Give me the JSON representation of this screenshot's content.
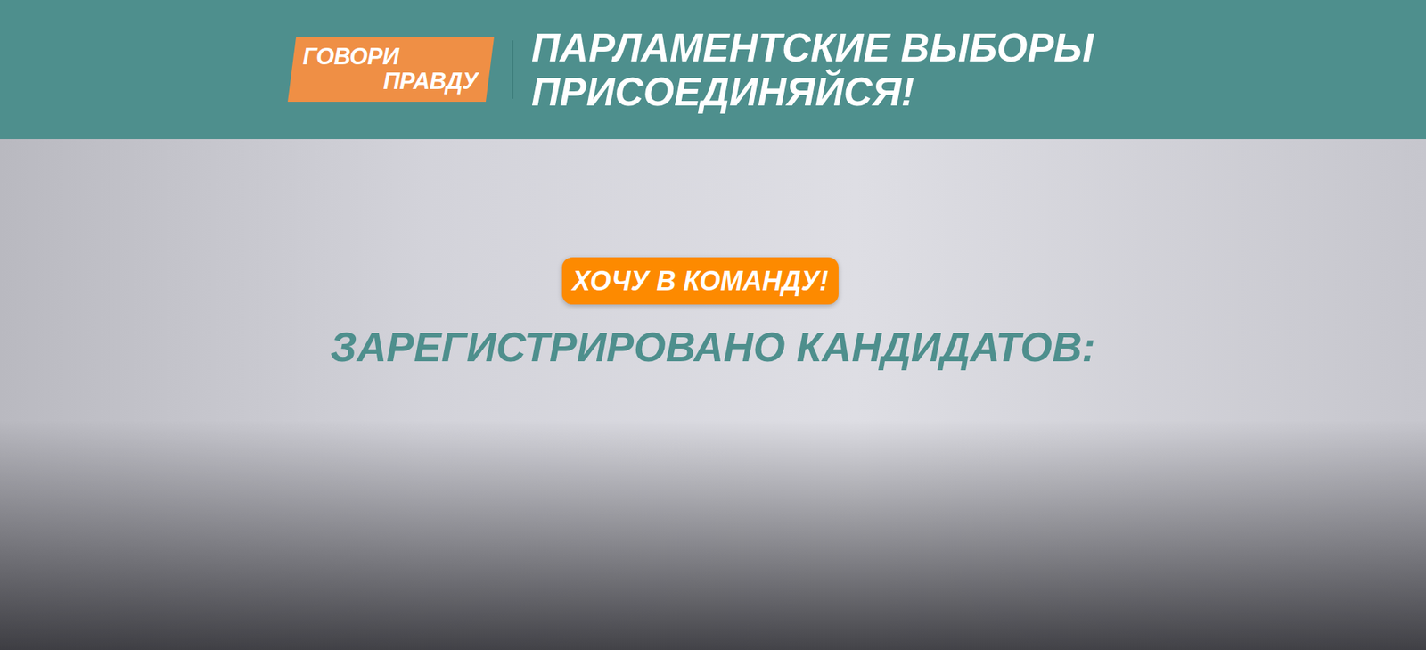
{
  "header": {
    "logo_lines": [
      "ГОВОРИ",
      "ПРАВДУ"
    ],
    "title_lines": [
      "ПАРЛАМЕНТСКИЕ ВЫБОРЫ",
      "ПРИСОЕДИНЯЙСЯ!"
    ]
  },
  "hero": {
    "button": "ХОЧУ В КОМАНДУ!",
    "counter_label": "ЗАРЕГИСТРИРОВАНО КАНДИДАТОВ:"
  }
}
